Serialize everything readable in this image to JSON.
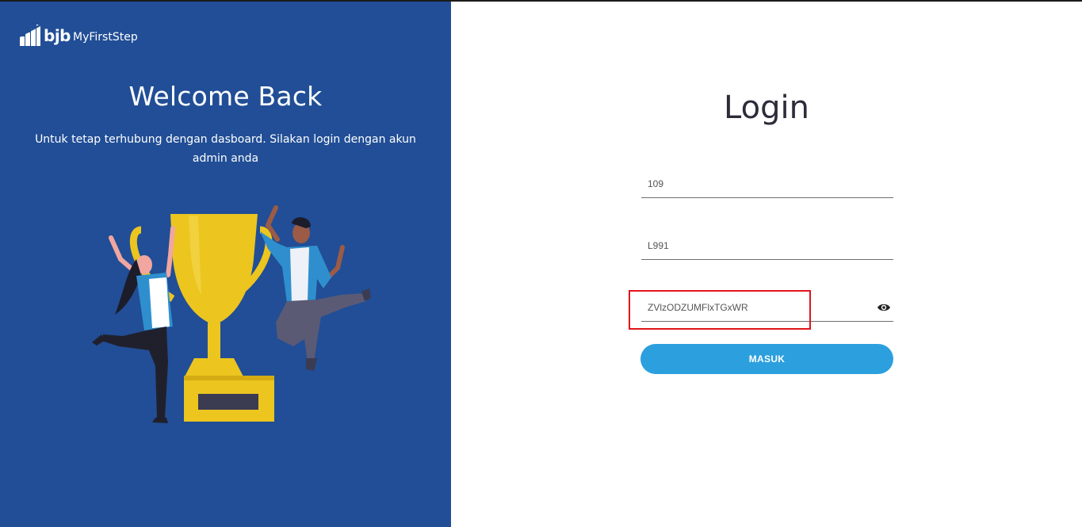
{
  "brand": {
    "short": "bjb",
    "name": "MyFirstStep",
    "icon": "bar-chart-logo-icon"
  },
  "welcome": {
    "title": "Welcome Back",
    "subtitle": "Untuk tetap terhubung dengan dasboard. Silakan login dengan akun admin anda"
  },
  "illustration": {
    "icon": "trophy-celebration-illustration"
  },
  "login": {
    "title": "Login",
    "fields": [
      {
        "value": "109",
        "type": "text"
      },
      {
        "value": "L991",
        "type": "text"
      },
      {
        "value": "ZVlzODZUMFlxTGxWR",
        "type": "text",
        "icon": "eye-icon"
      }
    ],
    "submit_label": "MASUK"
  },
  "colors": {
    "left_panel": "#214e96",
    "button": "#2c9fde",
    "highlight": "#e0141b",
    "trophy": "#ecc51f"
  }
}
